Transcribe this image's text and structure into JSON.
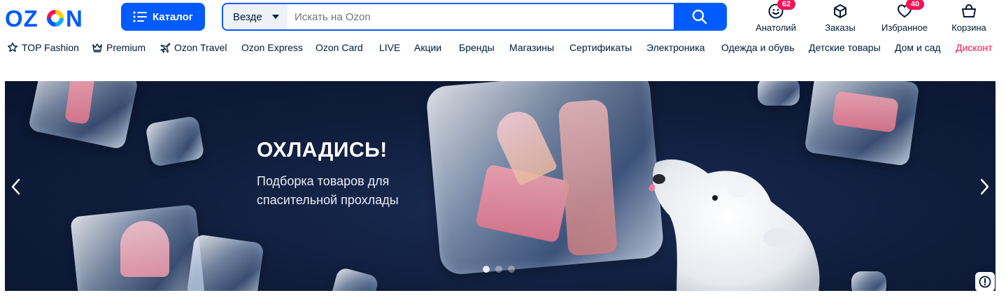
{
  "logo": {
    "text": "OZON"
  },
  "catalog": {
    "label": "Каталог",
    "icon": "menu-icon"
  },
  "search": {
    "scope": "Везде",
    "placeholder": "Искать на Ozon",
    "icon": "search-icon"
  },
  "user_nav": [
    {
      "label": "Анатолий",
      "icon": "smile-icon",
      "badge": "62"
    },
    {
      "label": "Заказы",
      "icon": "box-icon"
    },
    {
      "label": "Избранное",
      "icon": "heart-icon",
      "badge": "40"
    },
    {
      "label": "Корзина",
      "icon": "basket-icon"
    }
  ],
  "nav": [
    {
      "label": "TOP Fashion",
      "icon": "star-icon"
    },
    {
      "label": "Premium",
      "icon": "crown-icon"
    },
    {
      "label": "Ozon Travel",
      "icon": "plane-icon"
    },
    {
      "label": "Ozon Express"
    },
    {
      "label": "Ozon Card"
    },
    {
      "label": "LIVE"
    },
    {
      "label": "Акции"
    },
    {
      "label": "Бренды"
    },
    {
      "label": "Магазины"
    },
    {
      "label": "Сертификаты"
    },
    {
      "label": "Электроника"
    },
    {
      "label": "Одежда и обувь"
    },
    {
      "label": "Детские товары"
    },
    {
      "label": "Дом и сад"
    },
    {
      "label": "Дисконт",
      "color": "#f91155"
    }
  ],
  "banner": {
    "title": "ОХЛАДИСЬ!",
    "subtitle": "Подборка товаров для спасительной прохлады",
    "slides_total": 3,
    "active_slide": 1
  },
  "colors": {
    "brand": "#005bff",
    "accent": "#f91155",
    "banner_bg": "#0f1d3b"
  }
}
